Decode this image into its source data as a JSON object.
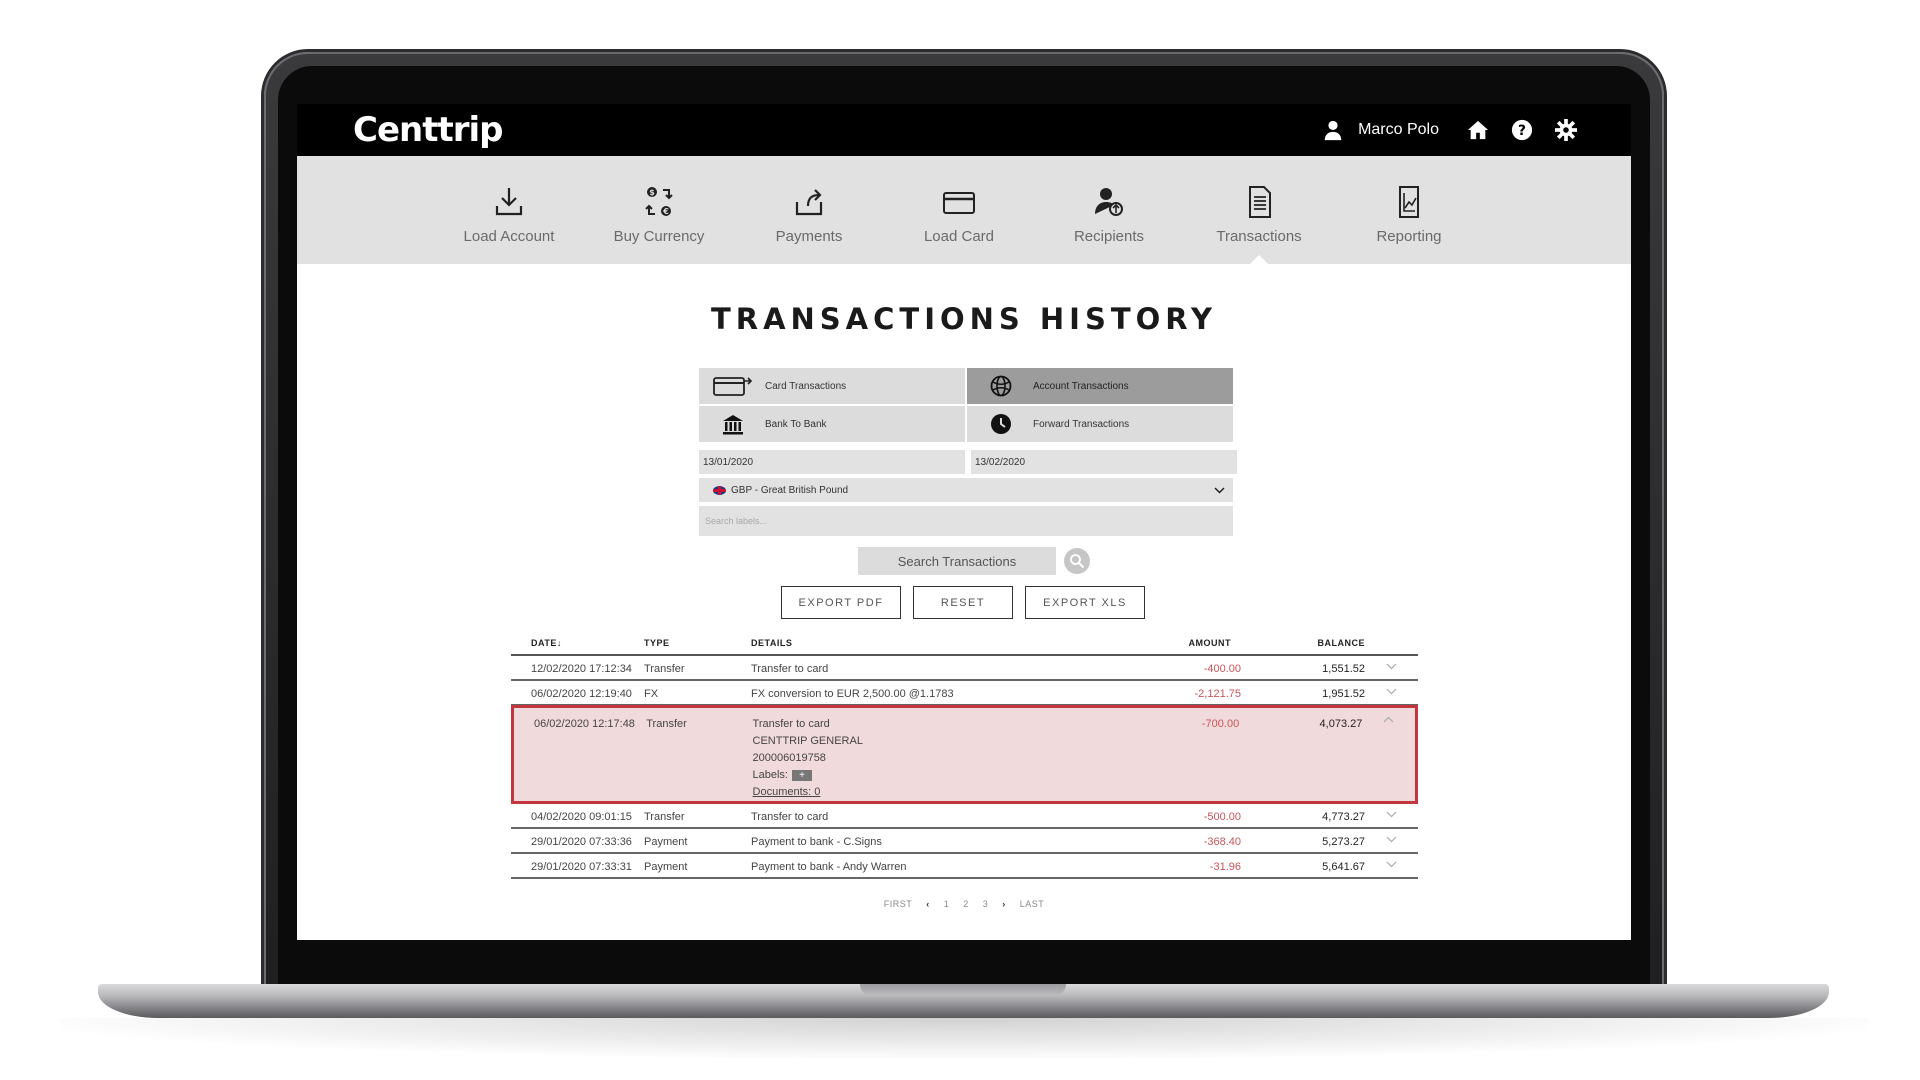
{
  "app": {
    "brand": "Centtrip"
  },
  "header": {
    "user_name": "Marco Polo",
    "icons": [
      "user-icon",
      "home-icon",
      "help-icon",
      "settings-icon"
    ]
  },
  "nav": {
    "items": [
      {
        "label": "Load Account",
        "icon": "download-icon"
      },
      {
        "label": "Buy Currency",
        "icon": "currency-exchange-icon"
      },
      {
        "label": "Payments",
        "icon": "upload-icon"
      },
      {
        "label": "Load Card",
        "icon": "card-icon"
      },
      {
        "label": "Recipients",
        "icon": "recipient-icon"
      },
      {
        "label": "Transactions",
        "icon": "document-icon",
        "active": true
      },
      {
        "label": "Reporting",
        "icon": "report-chart-icon"
      }
    ]
  },
  "page": {
    "title": "TRANSACTIONS HISTORY"
  },
  "filters": {
    "card_transactions": "Card Transactions",
    "account_transactions": "Account Transactions",
    "bank_to_bank": "Bank To Bank",
    "forward_transactions": "Forward Transactions",
    "selected": "Account Transactions",
    "date_from": "13/01/2020",
    "date_to": "13/02/2020",
    "currency": "GBP - Great British Pound",
    "labels_placeholder": "Search labels..."
  },
  "actions": {
    "search": "Search Transactions",
    "export_pdf": "EXPORT PDF",
    "reset": "RESET",
    "export_xls": "EXPORT XLS"
  },
  "table": {
    "headers": {
      "date": "DATE",
      "date_sort": "↓",
      "type": "TYPE",
      "details": "DETAILS",
      "amount": "AMOUNT",
      "balance": "BALANCE"
    },
    "rows": [
      {
        "date": "12/02/2020 17:12:34",
        "type": "Transfer",
        "details": "Transfer to card",
        "amount": "-400.00",
        "balance": "1,551.52"
      },
      {
        "date": "06/02/2020 12:19:40",
        "type": "FX",
        "details": "FX conversion to EUR 2,500.00 @1.1783",
        "amount": "-2,121.75",
        "balance": "1,951.52"
      },
      {
        "date": "06/02/2020 12:17:48",
        "type": "Transfer",
        "details": "Transfer to card",
        "details_line2": "CENTTRIP GENERAL",
        "details_line3": "200006019758",
        "labels_label": "Labels:",
        "labels_add": "+",
        "documents": "Documents: 0",
        "amount": "-700.00",
        "balance": "4,073.27",
        "expanded": true
      },
      {
        "date": "04/02/2020 09:01:15",
        "type": "Transfer",
        "details": "Transfer to card",
        "amount": "-500.00",
        "balance": "4,773.27"
      },
      {
        "date": "29/01/2020 07:33:36",
        "type": "Payment",
        "details": "Payment to bank - C.Signs",
        "amount": "-368.40",
        "balance": "5,273.27"
      },
      {
        "date": "29/01/2020 07:33:31",
        "type": "Payment",
        "details": "Payment to bank - Andy Warren",
        "amount": "-31.96",
        "balance": "5,641.67"
      }
    ]
  },
  "pagination": {
    "first": "FIRST",
    "pages": [
      "1",
      "2",
      "3"
    ],
    "last": "LAST"
  },
  "colors": {
    "header_bg": "#000000",
    "nav_bg": "#e1e1e1",
    "negative_amount": "#c9545a",
    "highlight_border": "#c3363e",
    "highlight_bg": "#f1dadb"
  }
}
